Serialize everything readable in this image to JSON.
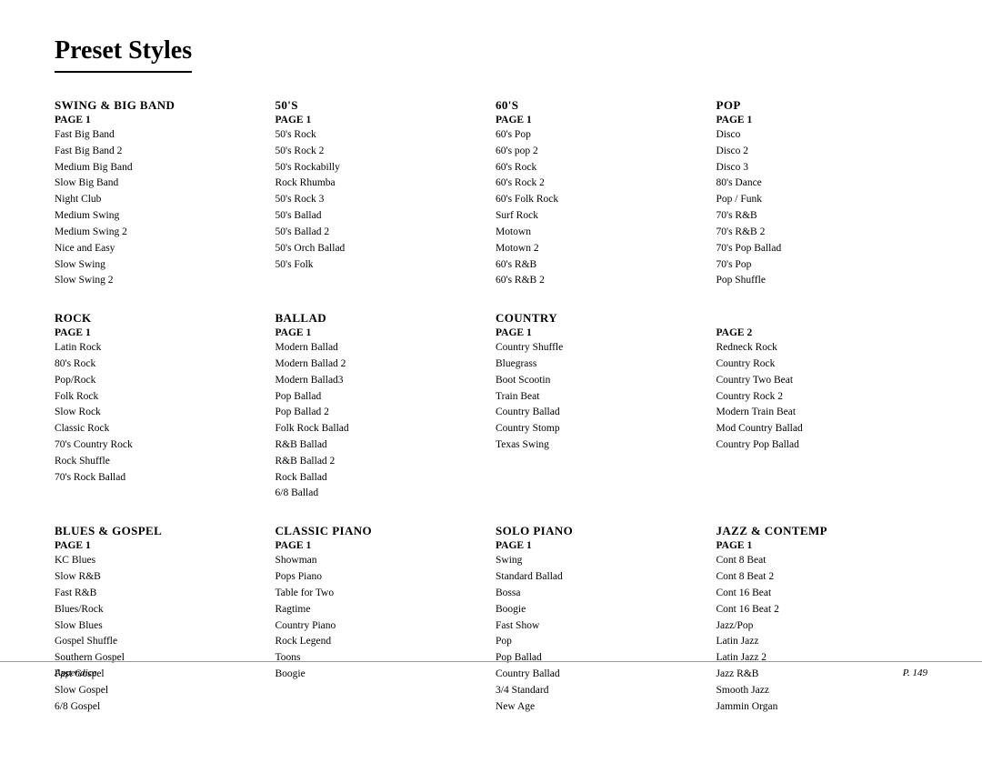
{
  "title": "Preset Styles",
  "footer": {
    "left": "Appendice",
    "right": "P. 149"
  },
  "sections": [
    {
      "id": "swing",
      "title": "SWING & BIG BAND",
      "pages": [
        {
          "label": "PAGE 1",
          "items": [
            "Fast Big Band",
            "Fast Big Band 2",
            "Medium Big Band",
            "Slow Big Band",
            "Night Club",
            "Medium Swing",
            "Medium Swing 2",
            "Nice and Easy",
            "Slow Swing",
            "Slow Swing 2"
          ]
        }
      ]
    },
    {
      "id": "50s",
      "title": "50'S",
      "pages": [
        {
          "label": "PAGE 1",
          "items": [
            "50's Rock",
            "50's Rock 2",
            "50's Rockabilly",
            "Rock Rhumba",
            "50's Rock 3",
            "50's Ballad",
            "50's Ballad 2",
            "50's Orch Ballad",
            "50's Folk"
          ]
        }
      ]
    },
    {
      "id": "60s",
      "title": "60'S",
      "pages": [
        {
          "label": "PAGE 1",
          "items": [
            "60's Pop",
            "60's pop 2",
            "60's Rock",
            "60's Rock 2",
            "60's Folk Rock",
            "Surf Rock",
            "Motown",
            "Motown 2",
            "60's R&B",
            "60's R&B 2"
          ]
        }
      ]
    },
    {
      "id": "pop",
      "title": "POP",
      "pages": [
        {
          "label": "PAGE 1",
          "items": [
            "Disco",
            "Disco 2",
            "Disco 3",
            "80's Dance",
            "Pop / Funk",
            "70's R&B",
            "70's R&B 2",
            "70's Pop Ballad",
            "70's Pop",
            "Pop Shuffle"
          ]
        }
      ]
    },
    {
      "id": "rock",
      "title": "ROCK",
      "pages": [
        {
          "label": "PAGE 1",
          "items": [
            "Latin Rock",
            "80's Rock",
            "Pop/Rock",
            "Folk Rock",
            "Slow Rock",
            "Classic Rock",
            "70's Country Rock",
            "Rock Shuffle",
            "70's Rock Ballad"
          ]
        }
      ]
    },
    {
      "id": "ballad",
      "title": "BALLAD",
      "pages": [
        {
          "label": "PAGE 1",
          "items": [
            "Modern Ballad",
            "Modern Ballad 2",
            "Modern Ballad3",
            "Pop Ballad",
            "Pop Ballad 2",
            "Folk Rock Ballad",
            "R&B Ballad",
            "R&B Ballad 2",
            "Rock Ballad",
            "6/8 Ballad"
          ]
        }
      ]
    },
    {
      "id": "country",
      "title": "COUNTRY",
      "pages": [
        {
          "label": "PAGE 1",
          "items": [
            "Country Shuffle",
            "Bluegrass",
            "Boot Scootin",
            "Train Beat",
            "Country Ballad",
            "Country Stomp",
            "Texas Swing"
          ]
        },
        {
          "label": "PAGE 2",
          "items": [
            "Redneck  Rock",
            "Country Rock",
            "Country Two Beat",
            "Country Rock 2",
            "Modern Train Beat",
            "Mod Country Ballad",
            "Country Pop Ballad"
          ]
        }
      ]
    },
    {
      "id": "blues",
      "title": "BLUES & GOSPEL",
      "pages": [
        {
          "label": "PAGE 1",
          "items": [
            "KC Blues",
            "Slow R&B",
            "Fast R&B",
            "Blues/Rock",
            "Slow Blues",
            "Gospel Shuffle",
            "Southern Gospel",
            "Fast Gospel",
            "Slow Gospel",
            "6/8 Gospel"
          ]
        }
      ]
    },
    {
      "id": "classic-piano",
      "title": "CLASSIC PIANO",
      "pages": [
        {
          "label": "PAGE 1",
          "items": [
            "Showman",
            "Pops Piano",
            "Table for Two",
            "Ragtime",
            "Country Piano",
            "Rock Legend",
            "Toons",
            "Boogie"
          ]
        }
      ]
    },
    {
      "id": "solo-piano",
      "title": "SOLO PIANO",
      "pages": [
        {
          "label": "PAGE 1",
          "items": [
            "Swing",
            "Standard Ballad",
            "Bossa",
            "Boogie",
            "Fast Show",
            "Pop",
            "Pop Ballad",
            "Country Ballad",
            "3/4 Standard",
            "New Age"
          ]
        }
      ]
    },
    {
      "id": "jazz",
      "title": "JAZZ & CONTEMP",
      "pages": [
        {
          "label": "PAGE 1",
          "items": [
            "Cont 8 Beat",
            "Cont 8 Beat 2",
            "Cont 16 Beat",
            "Cont 16 Beat 2",
            "Jazz/Pop",
            "Latin Jazz",
            "Latin Jazz 2",
            "Jazz R&B",
            "Smooth Jazz",
            "Jammin Organ"
          ]
        }
      ]
    }
  ]
}
